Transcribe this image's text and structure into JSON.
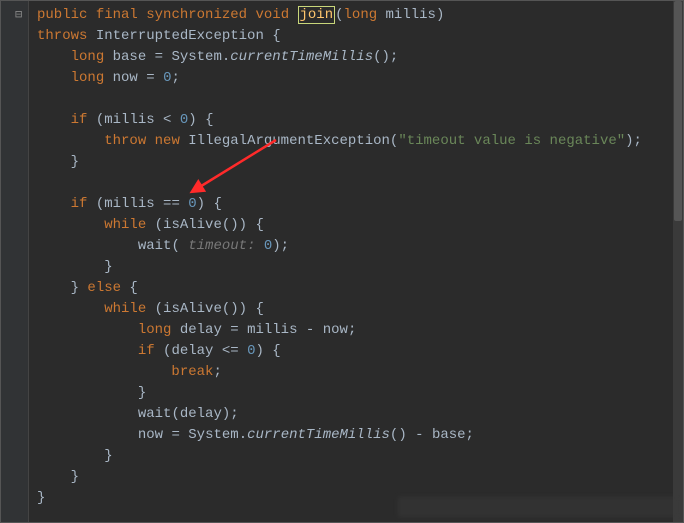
{
  "code": {
    "l1_public": "public",
    "l1_final": "final",
    "l1_sync": "synchronized",
    "l1_void": "void",
    "l1_method": "join",
    "l1_ptype": "long",
    "l1_pname": "millis",
    "l2_throws": "throws",
    "l2_ex": "InterruptedException",
    "l3_long": "long",
    "l3_base": "base",
    "l3_sys": "System",
    "l3_ctm": "currentTimeMillis",
    "l4_long": "long",
    "l4_now": "now",
    "l4_zero": "0",
    "l6_if": "if",
    "l6_millis": "millis",
    "l6_zero": "0",
    "l7_throw": "throw",
    "l7_new": "new",
    "l7_ex": "IllegalArgumentException",
    "l7_msg": "\"timeout value is negative\"",
    "l10_if": "if",
    "l10_millis": "millis",
    "l10_zero": "0",
    "l11_while": "while",
    "l11_isalive": "isAlive",
    "l12_wait": "wait",
    "l12_hint": "timeout:",
    "l12_zero": "0",
    "l14_else": "else",
    "l15_while": "while",
    "l15_isalive": "isAlive",
    "l16_long": "long",
    "l16_delay": "delay",
    "l16_millis": "millis",
    "l16_now": "now",
    "l17_if": "if",
    "l17_delay": "delay",
    "l17_zero": "0",
    "l18_break": "break",
    "l20_wait": "wait",
    "l20_delay": "delay",
    "l21_now": "now",
    "l21_sys": "System",
    "l21_ctm": "currentTimeMillis",
    "l21_base": "base"
  }
}
